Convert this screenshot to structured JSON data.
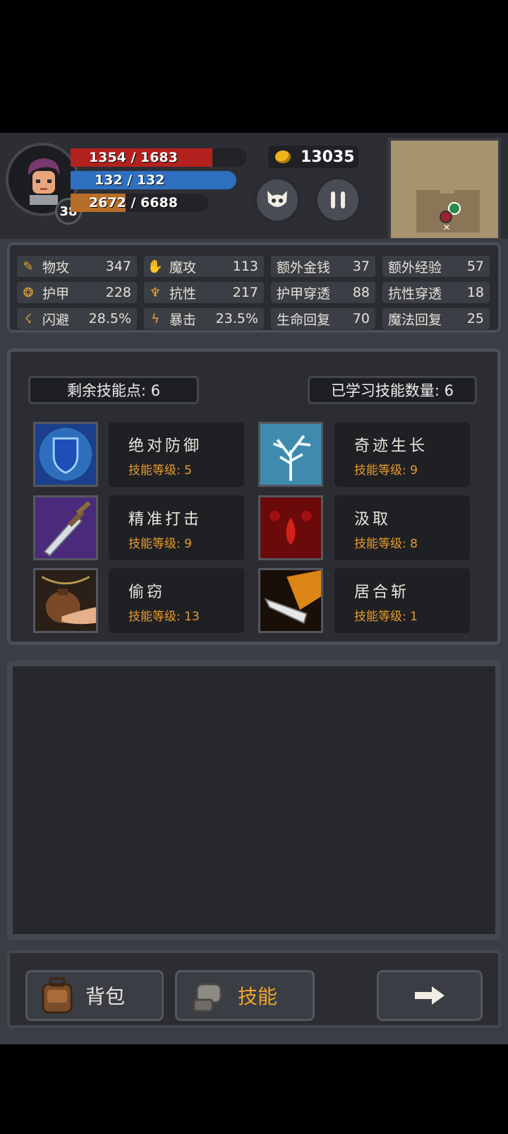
{
  "player": {
    "level": "38",
    "hp": "1354 / 1683",
    "hp_ratio": 0.804,
    "mp": "132 / 132",
    "mp_ratio": 1.0,
    "xp": "2672 / 6688",
    "xp_ratio": 0.4,
    "gold": "13035"
  },
  "stats": [
    {
      "icon": "sword-icon",
      "label": "物攻",
      "value": "347"
    },
    {
      "icon": "magic-hand-icon",
      "label": "魔攻",
      "value": "113"
    },
    {
      "icon": "",
      "label": "额外金钱",
      "value": "37"
    },
    {
      "icon": "",
      "label": "额外经验",
      "value": "57"
    },
    {
      "icon": "paw-icon",
      "label": "护甲",
      "value": "228"
    },
    {
      "icon": "muscle-icon",
      "label": "抗性",
      "value": "217"
    },
    {
      "icon": "",
      "label": "护甲穿透",
      "value": "88"
    },
    {
      "icon": "",
      "label": "抗性穿透",
      "value": "18"
    },
    {
      "icon": "running-icon",
      "label": "闪避",
      "value": "28.5%"
    },
    {
      "icon": "lightning-icon",
      "label": "暴击",
      "value": "23.5%"
    },
    {
      "icon": "",
      "label": "生命回复",
      "value": "70"
    },
    {
      "icon": "",
      "label": "魔法回复",
      "value": "25"
    }
  ],
  "skills_panel": {
    "remaining_points": "剩余技能点: 6",
    "learned_count": "已学习技能数量: 6",
    "skills": [
      {
        "name": "绝对防御",
        "level": "技能等级: 5",
        "icon": "shield-icon"
      },
      {
        "name": "奇迹生长",
        "level": "技能等级: 9",
        "icon": "tree-icon"
      },
      {
        "name": "精准打击",
        "level": "技能等级: 9",
        "icon": "sword-strike-icon"
      },
      {
        "name": "汲取",
        "level": "技能等级: 8",
        "icon": "blood-drop-icon"
      },
      {
        "name": "偷窃",
        "level": "技能等级: 13",
        "icon": "money-bag-icon"
      },
      {
        "name": "居合斩",
        "level": "技能等级: 1",
        "icon": "flaming-blade-icon"
      }
    ]
  },
  "bottom_nav": {
    "bag_label": "背包",
    "skills_label": "技能"
  },
  "colors": {
    "hp": "#b3211f",
    "mp": "#2f6fbf",
    "xp": "#b86e2a",
    "accent": "#e79a2c"
  }
}
